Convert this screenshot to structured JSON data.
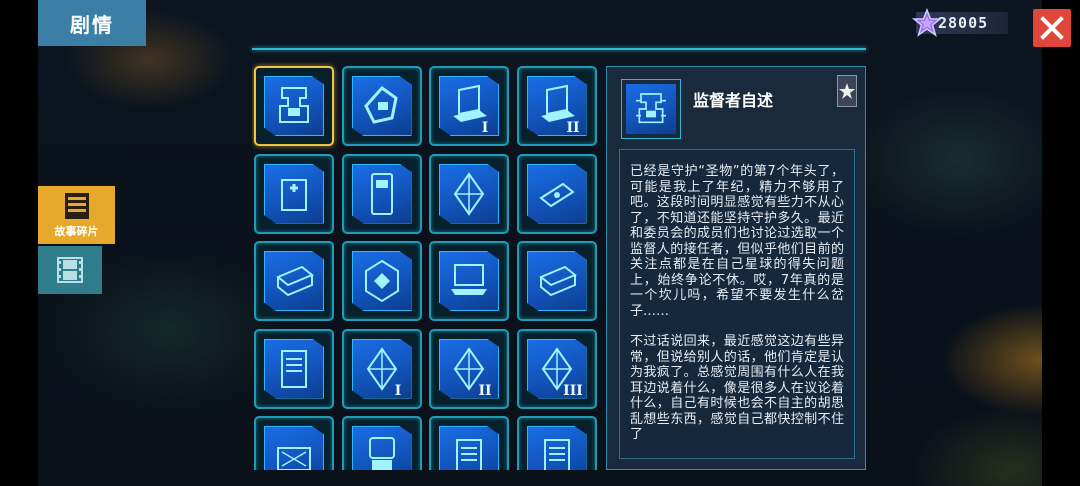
{
  "header": {
    "title": "剧情",
    "currency_amount": "28005",
    "close_icon": "close-icon"
  },
  "side_menu": {
    "story_fragments_label": "故事碎片",
    "story_icon": "document-icon",
    "video_icon": "film-icon"
  },
  "grid": {
    "items": [
      {
        "icon": "circuit-board-icon",
        "numeral": "",
        "selected": true
      },
      {
        "icon": "emblem-icon",
        "numeral": ""
      },
      {
        "icon": "laptop-icon",
        "numeral": "I"
      },
      {
        "icon": "laptop-icon",
        "numeral": "II"
      },
      {
        "icon": "medical-device-icon",
        "numeral": ""
      },
      {
        "icon": "terminal-device-icon",
        "numeral": ""
      },
      {
        "icon": "crystal-icon",
        "numeral": ""
      },
      {
        "icon": "usb-drive-icon",
        "numeral": ""
      },
      {
        "icon": "book-icon",
        "numeral": ""
      },
      {
        "icon": "hex-emblem-icon",
        "numeral": ""
      },
      {
        "icon": "laptop-open-icon",
        "numeral": ""
      },
      {
        "icon": "book-icon",
        "numeral": ""
      },
      {
        "icon": "tablet-icon",
        "numeral": ""
      },
      {
        "icon": "crystal-icon",
        "numeral": "I"
      },
      {
        "icon": "crystal-icon",
        "numeral": "II"
      },
      {
        "icon": "crystal-icon",
        "numeral": "III"
      },
      {
        "icon": "scanner-icon",
        "numeral": ""
      },
      {
        "icon": "robot-icon",
        "numeral": ""
      },
      {
        "icon": "document-icon",
        "numeral": ""
      },
      {
        "icon": "document-icon",
        "numeral": ""
      }
    ]
  },
  "detail": {
    "title": "监督者自述",
    "paragraphs": [
      "已经是守护“圣物”的第7个年头了，可能是我上了年纪，精力不够用了吧。这段时间明显感觉有些力不从心了，不知道还能坚持守护多久。最近和委员会的成员们也讨论过选取一个监督人的接任者，但似乎他们目前的关注点都是在自己星球的得失问题上，始终争论不休。哎，7年真的是一个坎儿吗，希望不要发生什么岔子……",
      "不过话说回来，最近感觉这边有些异常，但说给别人的话，他们肯定是认为我疯了。总感觉周围有什么人在我耳边说着什么，像是很多人在议论着什么，自己有时候也会不自主的胡思乱想些东西，感觉自己都快控制不住了"
    ]
  },
  "colors": {
    "accent": "#2bb8d2",
    "selected_border": "#f2c445",
    "story_tab": "#e6a92c",
    "close": "#e0463a"
  }
}
